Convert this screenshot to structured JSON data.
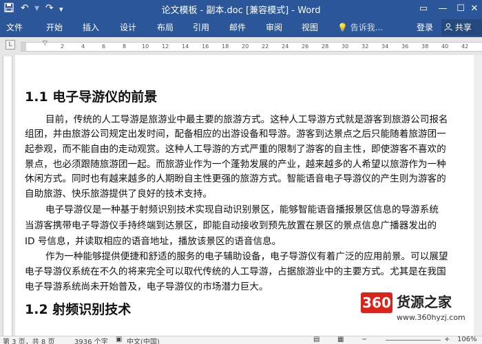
{
  "window": {
    "title": "论文模板 - 副本.doc [兼容模式] - Word",
    "buttons": {
      "restore": "▭",
      "minimize": "—",
      "maximize": "☐",
      "close": "✕"
    }
  },
  "quick_access": {
    "save_icon": "save-icon",
    "undo": "↶",
    "redo": "↷",
    "customize": "▾"
  },
  "ribbon": {
    "tabs": [
      "文件",
      "开始",
      "插入",
      "设计",
      "布局",
      "引用",
      "邮件",
      "审阅",
      "视图"
    ],
    "tell_me": "告诉我...",
    "login": "登录",
    "share": "共享"
  },
  "ruler": {
    "marks": [
      "2",
      "4",
      "6",
      "8",
      "10",
      "12",
      "14",
      "16",
      "18",
      "20",
      "22",
      "24",
      "26",
      "28",
      "30",
      "32",
      "34",
      "36",
      "38",
      "40",
      "42"
    ],
    "tab_marker": "L"
  },
  "document": {
    "heading1": "1.1  电子导游仪的前景",
    "lines": [
      "目前，传统的人工导游是旅游业中最主要的旅游方式。这种人工导游方式就是游客到旅游公司报名",
      "组团，并由旅游公司规定出发时间，配备相应的出游设备和导游。游客到达景点之后只能随着旅游团一",
      "起参观，而不能自由的走动观赏。这种人工导游的方式严重的限制了游客的自主性，即使游客不喜欢的",
      "景点，也必须跟随旅游团一起。而旅游业作为一个蓬勃发展的产业，越来越多的人希望以旅游作为一种",
      "休闲方式。同时也有越来越多的人期盼自主性更强的旅游方式。智能语音电子导游仪的产生则为游客的",
      "自助旅游、快乐旅游提供了良好的技术支持。",
      "电子导游仪是一种基于射频识别技术实现自动识别景区，能够智能语音播报景区信息的导游系统",
      "当游客携带电子导游仪手持终端到达景区，即能自动接收到预先放置在景区的景点信息广播器发出的",
      "ID 号信息，并读取相应的语音地址，播放该景区的语音信息。",
      "作为一种能够提供便捷和舒适的服务的电子辅助设备，电子导游仪有着广泛的应用前景。可以展望",
      "电子导游仪系统在不久的将来完全可以取代传统的人工导游，占据旅游业中的主要方式。尤其是在我国",
      "电子导游系统尚未开始普及，电子导游仪的市场潜力巨大。"
    ],
    "heading2": "1.2  射频识别技术"
  },
  "watermark": {
    "logo": "360",
    "name": "货源之家",
    "url": "www.360hyzj.com"
  },
  "status": {
    "page": "第 3 页，共 8 页",
    "words": "3936 个字",
    "language": "中文(中国)",
    "zoom": "106%"
  }
}
